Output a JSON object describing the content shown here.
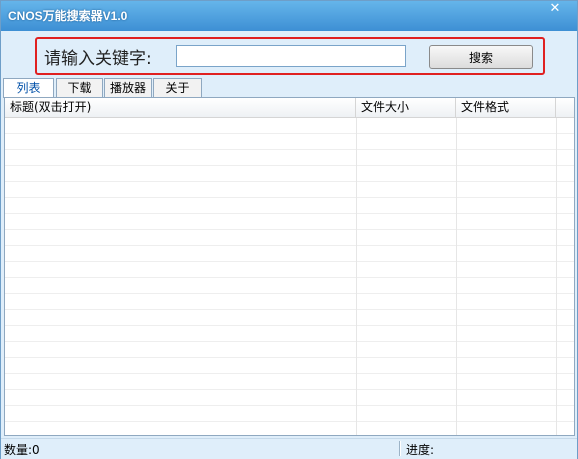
{
  "window": {
    "title": "CNOS万能搜索器V1.0",
    "close_glyph": "✕"
  },
  "search": {
    "label": "请输入关键字:",
    "value": "",
    "placeholder": "",
    "button_label": "搜索"
  },
  "tabs": [
    {
      "label": "列表",
      "active": true
    },
    {
      "label": "下载",
      "active": false
    },
    {
      "label": "播放器",
      "active": false
    },
    {
      "label": "关于",
      "active": false
    }
  ],
  "list": {
    "columns": [
      "标题(双击打开)",
      "文件大小",
      "文件格式"
    ],
    "rows": []
  },
  "status": {
    "count": "数量:0",
    "progress": "进度:"
  },
  "colors": {
    "titlebar": "#3d8fd4",
    "highlight_border": "#e02020",
    "active_tab_text": "#0050a8"
  }
}
